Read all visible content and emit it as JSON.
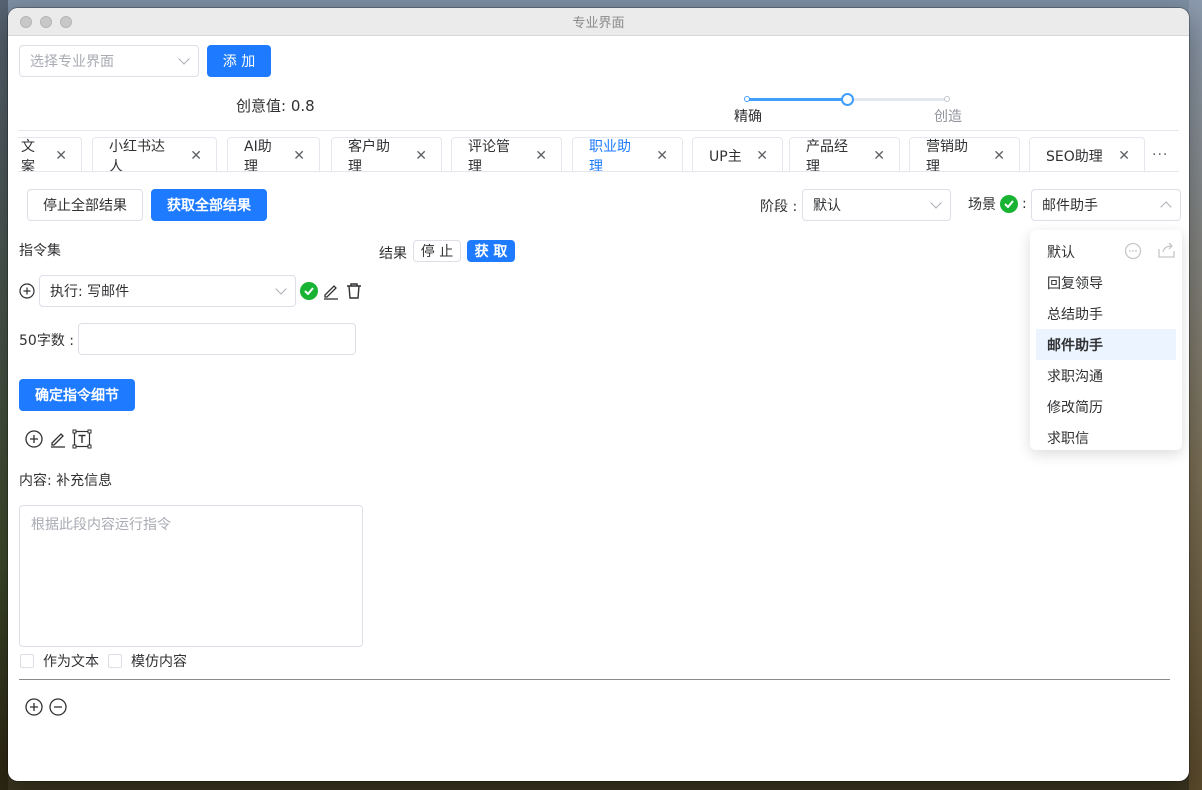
{
  "window": {
    "title": "专业界面"
  },
  "toolbar": {
    "select_placeholder": "选择专业界面",
    "add_label": "添 加",
    "creativity_label": "创意值: 0.8",
    "creativity_value": 0.8,
    "slider_left": "精确",
    "slider_right": "创造"
  },
  "tabs": [
    {
      "label": "文案",
      "partial": true
    },
    {
      "label": "小红书达人"
    },
    {
      "label": "AI助理"
    },
    {
      "label": "客户助理"
    },
    {
      "label": "评论管理"
    },
    {
      "label": "职业助理",
      "active": true
    },
    {
      "label": "UP主"
    },
    {
      "label": "产品经理"
    },
    {
      "label": "营销助理"
    },
    {
      "label": "SEO助理"
    }
  ],
  "tabs_more": "···",
  "actions": {
    "stop_all": "停止全部结果",
    "get_all": "获取全部结果",
    "stage_label": "阶段 :",
    "stage_value": "默认",
    "scene_label": "场景",
    "scene_colon": ":",
    "scene_value": "邮件助手"
  },
  "scene_options": [
    "默认",
    "回复领导",
    "总结助手",
    "邮件助手",
    "求职沟通",
    "修改简历",
    "求职信"
  ],
  "scene_selected": "邮件助手",
  "left": {
    "command_set": "指令集",
    "command_select": "执行: 写邮件",
    "word_count_label": "50字数 :",
    "confirm_button": "确定指令细节",
    "content_label": "内容: 补充信息",
    "content_placeholder": "根据此段内容运行指令",
    "as_text": "作为文本",
    "imitate": "模仿内容"
  },
  "result": {
    "label": "结果",
    "stop": "停 止",
    "fetch": "获 取"
  },
  "colors": {
    "primary": "#1e7bff",
    "success": "#18b332"
  }
}
